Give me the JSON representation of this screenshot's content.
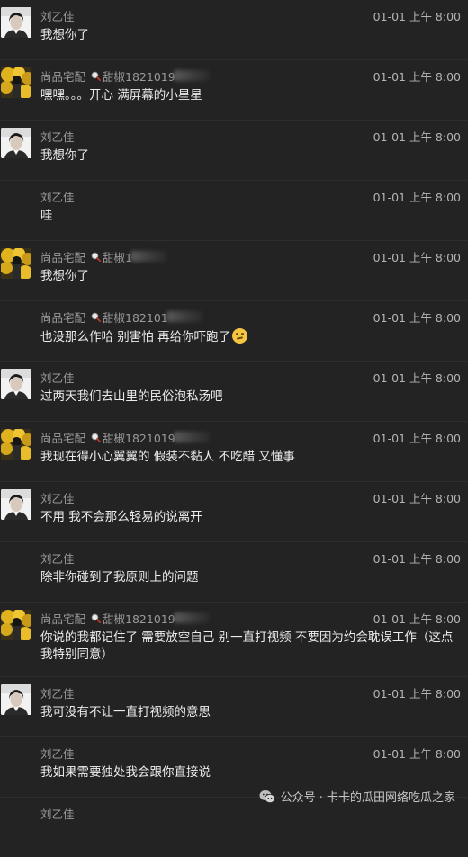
{
  "messages": [
    {
      "sender": "刘乙佳",
      "avatar": "liu",
      "show_avatar": true,
      "time": "01-01 上午 8:00",
      "text": "我想你了"
    },
    {
      "sender": "尚品宅配",
      "tag": "甜椒1821019",
      "avatar": "shang",
      "show_avatar": true,
      "time": "01-01 上午 8:00",
      "text": "嘿嘿。。。开心 满屏幕的小星星"
    },
    {
      "sender": "刘乙佳",
      "avatar": "liu",
      "show_avatar": true,
      "time": "01-01 上午 8:00",
      "text": "我想你了"
    },
    {
      "sender": "刘乙佳",
      "avatar": "liu",
      "show_avatar": false,
      "time": "01-01 上午 8:00",
      "text": "哇"
    },
    {
      "sender": "尚品宅配",
      "tag": "甜椒1",
      "avatar": "shang",
      "show_avatar": true,
      "time": "01-01 上午 8:00",
      "text": "我想你了"
    },
    {
      "sender": "尚品宅配",
      "tag": "甜椒182101",
      "avatar": "shang",
      "show_avatar": false,
      "time": "01-01 上午 8:00",
      "text": "也没那么作哈 别害怕 再给你吓跑了",
      "emoji": "thinking-face-emoji"
    },
    {
      "sender": "刘乙佳",
      "avatar": "liu",
      "show_avatar": true,
      "time": "01-01 上午 8:00",
      "text": "过两天我们去山里的民俗泡私汤吧"
    },
    {
      "sender": "尚品宅配",
      "tag": "甜椒1821019",
      "avatar": "shang",
      "show_avatar": true,
      "time": "01-01 上午 8:00",
      "text": "我现在得小心翼翼的 假装不黏人 不吃醋 又懂事"
    },
    {
      "sender": "刘乙佳",
      "avatar": "liu",
      "show_avatar": true,
      "time": "01-01 上午 8:00",
      "text": "不用 我不会那么轻易的说离开"
    },
    {
      "sender": "刘乙佳",
      "avatar": "liu",
      "show_avatar": false,
      "time": "01-01 上午 8:00",
      "text": "除非你碰到了我原则上的问题"
    },
    {
      "sender": "尚品宅配",
      "tag": "甜椒1821019",
      "avatar": "shang",
      "show_avatar": true,
      "time": "01-01 上午 8:00",
      "text": "你说的我都记住了 需要放空自己 别一直打视频 不要因为约会耽误工作（这点我特别同意）"
    },
    {
      "sender": "刘乙佳",
      "avatar": "liu",
      "show_avatar": true,
      "time": "01-01 上午 8:00",
      "text": "我可没有不让一直打视频的意思"
    },
    {
      "sender": "刘乙佳",
      "avatar": "liu",
      "show_avatar": false,
      "time": "01-01 上午 8:00",
      "text": "我如果需要独处我会跟你直接说"
    },
    {
      "sender": "刘乙佳",
      "avatar": "liu",
      "show_avatar": false,
      "time": "",
      "text": ""
    }
  ],
  "watermark": {
    "text": "公众号 · 卡卡的瓜田网络吃瓜之家",
    "icon": "wechat-icon"
  },
  "colors": {
    "background": "#232323",
    "sender": "#9a9a9a",
    "time": "#b3b3b3",
    "text": "#ececec"
  }
}
